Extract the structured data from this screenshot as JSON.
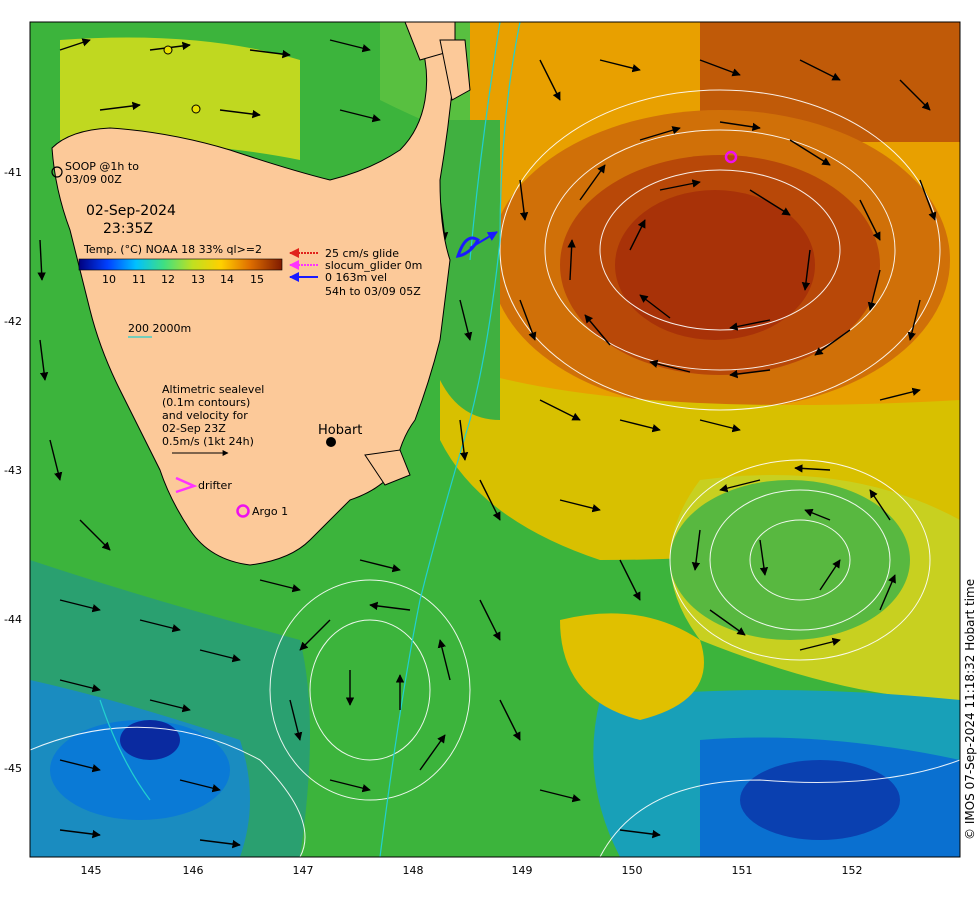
{
  "map": {
    "date": "02-Sep-2024",
    "time": "23:35Z",
    "soop_label": [
      "SOOP @1h to",
      "03/09 00Z"
    ],
    "temp_legend_title": "Temp. (°C) NOAA 18 33% ql>=2",
    "temp_ticks": [
      "10",
      "11",
      "12",
      "13",
      "14",
      "15"
    ],
    "glider_legend": [
      "25 cm/s glide",
      "slocum_glider 0m",
      "0 163m vel",
      "54h to 03/09 05Z"
    ],
    "depth_contours_label": "200  2000m",
    "altimetry_text": [
      "Altimetric sealevel",
      "(0.1m contours)",
      "and velocity for",
      "02-Sep 23Z",
      "0.5m/s (1kt 24h)"
    ],
    "city_label": "Hobart",
    "drifter_label": "drifter",
    "argo_label": "Argo 1",
    "credit": "© IMOS 07-Sep-2024 11:18:32 Hobart time",
    "lon_ticks": [
      "145",
      "146",
      "147",
      "148",
      "149",
      "150",
      "151",
      "152"
    ],
    "lat_ticks": [
      "-41",
      "-42",
      "-43",
      "-44",
      "-45"
    ],
    "colors": {
      "land": "#fcc999",
      "warm_core": "#a83208",
      "cool_water": "#3caa3c",
      "cold_water": "#0a7ad6",
      "glider_red": "#e0231b",
      "glider_magenta": "#ff33ff",
      "glider_blue": "#1a1aff",
      "argo_magenta": "#ee11ee",
      "contour_cyan": "#22d0d0"
    }
  }
}
